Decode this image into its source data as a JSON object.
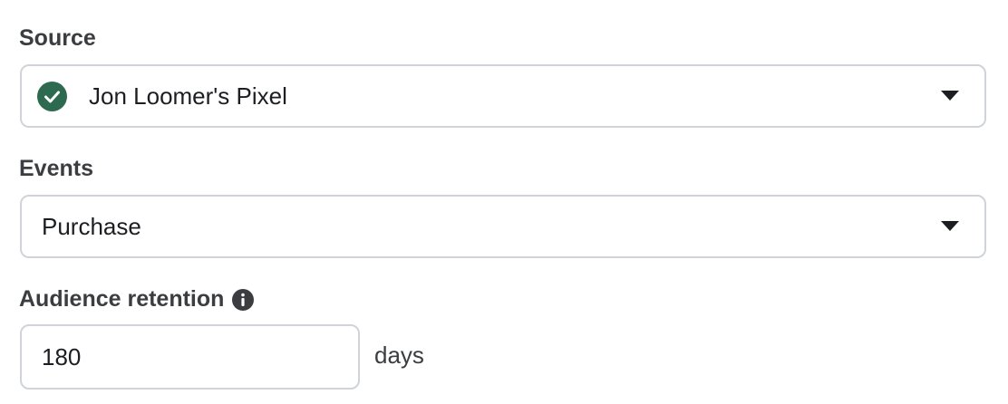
{
  "source": {
    "label": "Source",
    "selected_value": "Jon Loomer's Pixel",
    "status_icon": "check-circle-icon",
    "status_color": "#2d6a4f",
    "dropdown_icon": "caret-down-icon"
  },
  "events": {
    "label": "Events",
    "selected_value": "Purchase",
    "dropdown_icon": "caret-down-icon"
  },
  "retention": {
    "label": "Audience retention",
    "info_icon": "info-icon",
    "value": "180",
    "unit": "days"
  },
  "colors": {
    "border": "#d0d3d7",
    "label_text": "#3b3d40",
    "body_text": "#1c1e21",
    "success_green": "#2d6a4f"
  }
}
